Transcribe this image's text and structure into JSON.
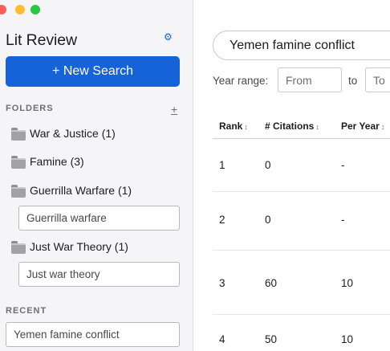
{
  "sidebar": {
    "title": "Lit Review",
    "settings_icon": "gear-icon",
    "new_search_label": "+ New Search",
    "folders_title": "FOLDERS",
    "add_folder_label": "+",
    "folders": [
      {
        "label": "War & Justice (1)",
        "icon": "folder-icon"
      },
      {
        "label": "Famine (3)",
        "icon": "folder-icon"
      },
      {
        "label": "Guerrilla Warfare (1)",
        "icon": "folder-icon"
      },
      {
        "label": "Just War Theory (1)",
        "icon": "folder-icon"
      }
    ],
    "folder_subitems": [
      "Guerrilla warfare",
      "Just war theory"
    ],
    "recent_title": "RECENT",
    "recent": [
      "Yemen famine conflict"
    ]
  },
  "main": {
    "search_value": "Yemen famine conflict",
    "year_range_label": "Year range:",
    "year_from_placeholder": "From",
    "year_to_label": "to",
    "year_to_placeholder": "To",
    "table": {
      "headers": [
        "Rank",
        "# Citations",
        "Per Year"
      ],
      "rows": [
        {
          "rank": "1",
          "citations": "0",
          "per_year": "-"
        },
        {
          "rank": "2",
          "citations": "0",
          "per_year": "-"
        },
        {
          "rank": "3",
          "citations": "60",
          "per_year": "10"
        },
        {
          "rank": "4",
          "citations": "50",
          "per_year": "10"
        }
      ]
    }
  },
  "colors": {
    "accent": "#1662d8",
    "sidebar_bg": "#f5f5f7"
  }
}
